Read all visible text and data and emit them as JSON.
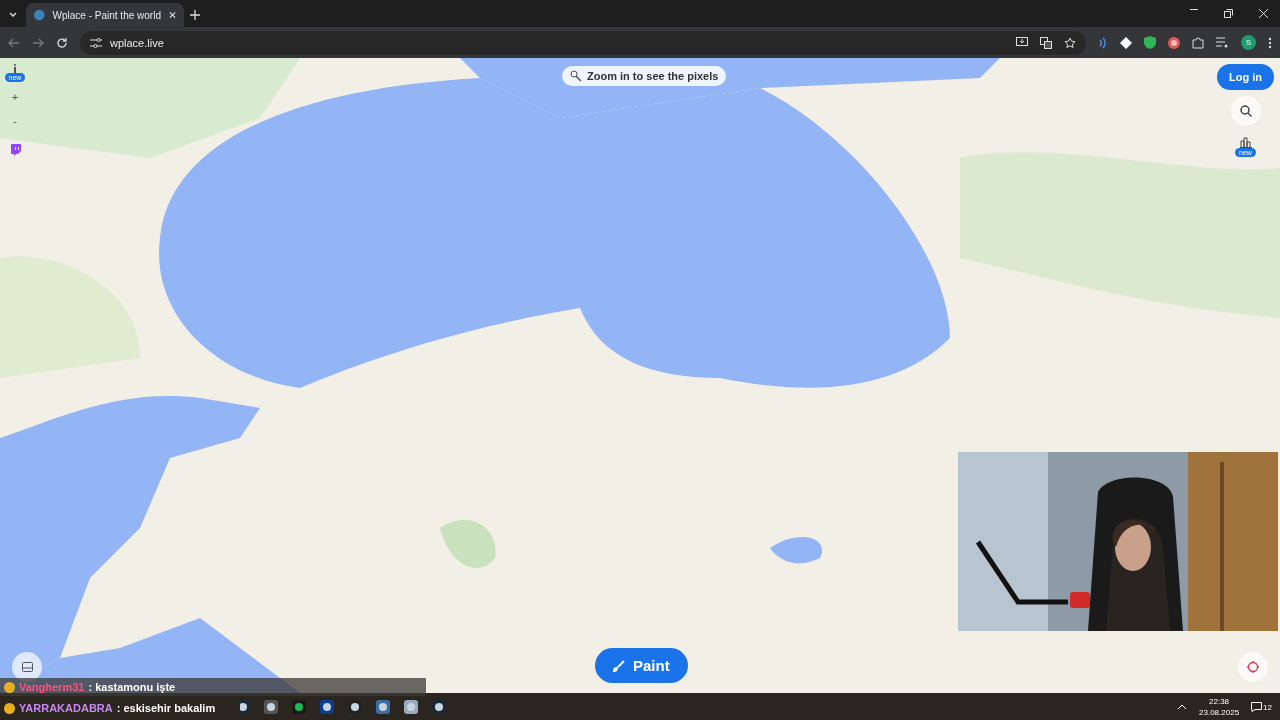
{
  "browser": {
    "tabs": [
      {
        "title": "Wplace - Paint the world",
        "selected": true
      }
    ],
    "address": "wplace.live",
    "profile_initial": "S"
  },
  "page": {
    "hint": "Zoom in to see the pixels",
    "left_controls": [
      {
        "kind": "info",
        "badge": "new"
      },
      {
        "kind": "zoom",
        "label": "+"
      },
      {
        "kind": "zoom",
        "label": "-"
      },
      {
        "kind": "twitch"
      }
    ],
    "login": "Log in",
    "right_controls": [
      {
        "kind": "search-map"
      },
      {
        "kind": "chart",
        "badge": "new"
      }
    ],
    "paint": "Paint"
  },
  "chat": [
    {
      "user": "Vangherm31",
      "text": ": kastamonu işte",
      "color": "#ff4f7e"
    },
    {
      "user": "YARRAKADABRA",
      "text": ": eskisehir bakalim",
      "color": "#c987f5"
    }
  ],
  "taskbar": {
    "time": "22:38",
    "date": "23.08.2025",
    "notifications": "12"
  }
}
